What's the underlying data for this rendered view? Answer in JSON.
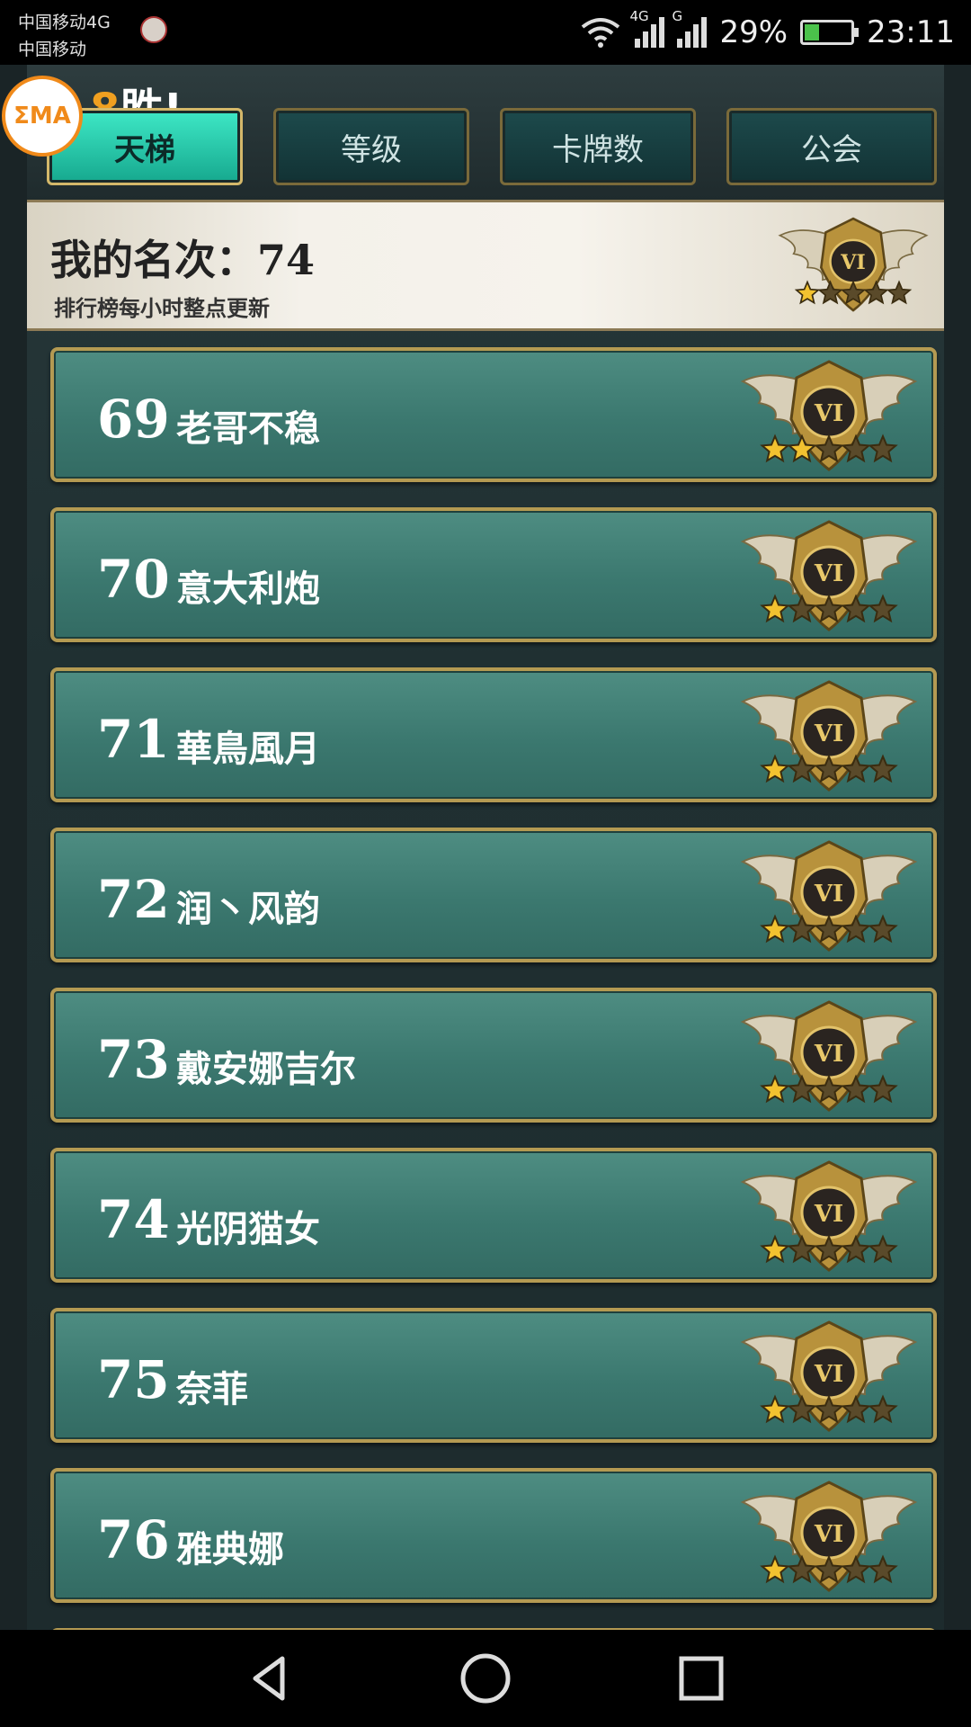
{
  "status_bar": {
    "carrier_1": "中国移动4G",
    "carrier_2": "中国移动",
    "net_1": "4G",
    "net_2": "G",
    "battery": "29%",
    "time": "23:11"
  },
  "overlay": {
    "logo_text": "ΣMA"
  },
  "header": {
    "win_digit": "8",
    "win_label": "胜!"
  },
  "tabs": [
    {
      "label": "天梯",
      "active": true
    },
    {
      "label": "等级",
      "active": false
    },
    {
      "label": "卡牌数",
      "active": false
    },
    {
      "label": "公会",
      "active": false
    }
  ],
  "my_rank": {
    "label": "我的名次：74",
    "note": "排行榜每小时整点更新",
    "tier": "VI",
    "stars_filled": 1,
    "stars_total": 5
  },
  "leaderboard": [
    {
      "rank": "69",
      "name": "老哥不稳",
      "tier": "VI",
      "stars_filled": 2
    },
    {
      "rank": "70",
      "name": "意大利炮",
      "tier": "VI",
      "stars_filled": 1
    },
    {
      "rank": "71",
      "name": "華鳥風月",
      "tier": "VI",
      "stars_filled": 1
    },
    {
      "rank": "72",
      "name": "润丶风韵",
      "tier": "VI",
      "stars_filled": 1
    },
    {
      "rank": "73",
      "name": "戴安娜吉尔",
      "tier": "VI",
      "stars_filled": 1
    },
    {
      "rank": "74",
      "name": "光阴猫女",
      "tier": "VI",
      "stars_filled": 1
    },
    {
      "rank": "75",
      "name": "奈菲",
      "tier": "VI",
      "stars_filled": 1
    },
    {
      "rank": "76",
      "name": "雅典娜",
      "tier": "VI",
      "stars_filled": 1
    }
  ],
  "nav": {
    "back": "back-icon",
    "home": "home-icon",
    "recents": "recents-icon"
  },
  "colors": {
    "accent": "#2bd3b4",
    "gold": "#c9a24a",
    "row": "#4a887d"
  }
}
